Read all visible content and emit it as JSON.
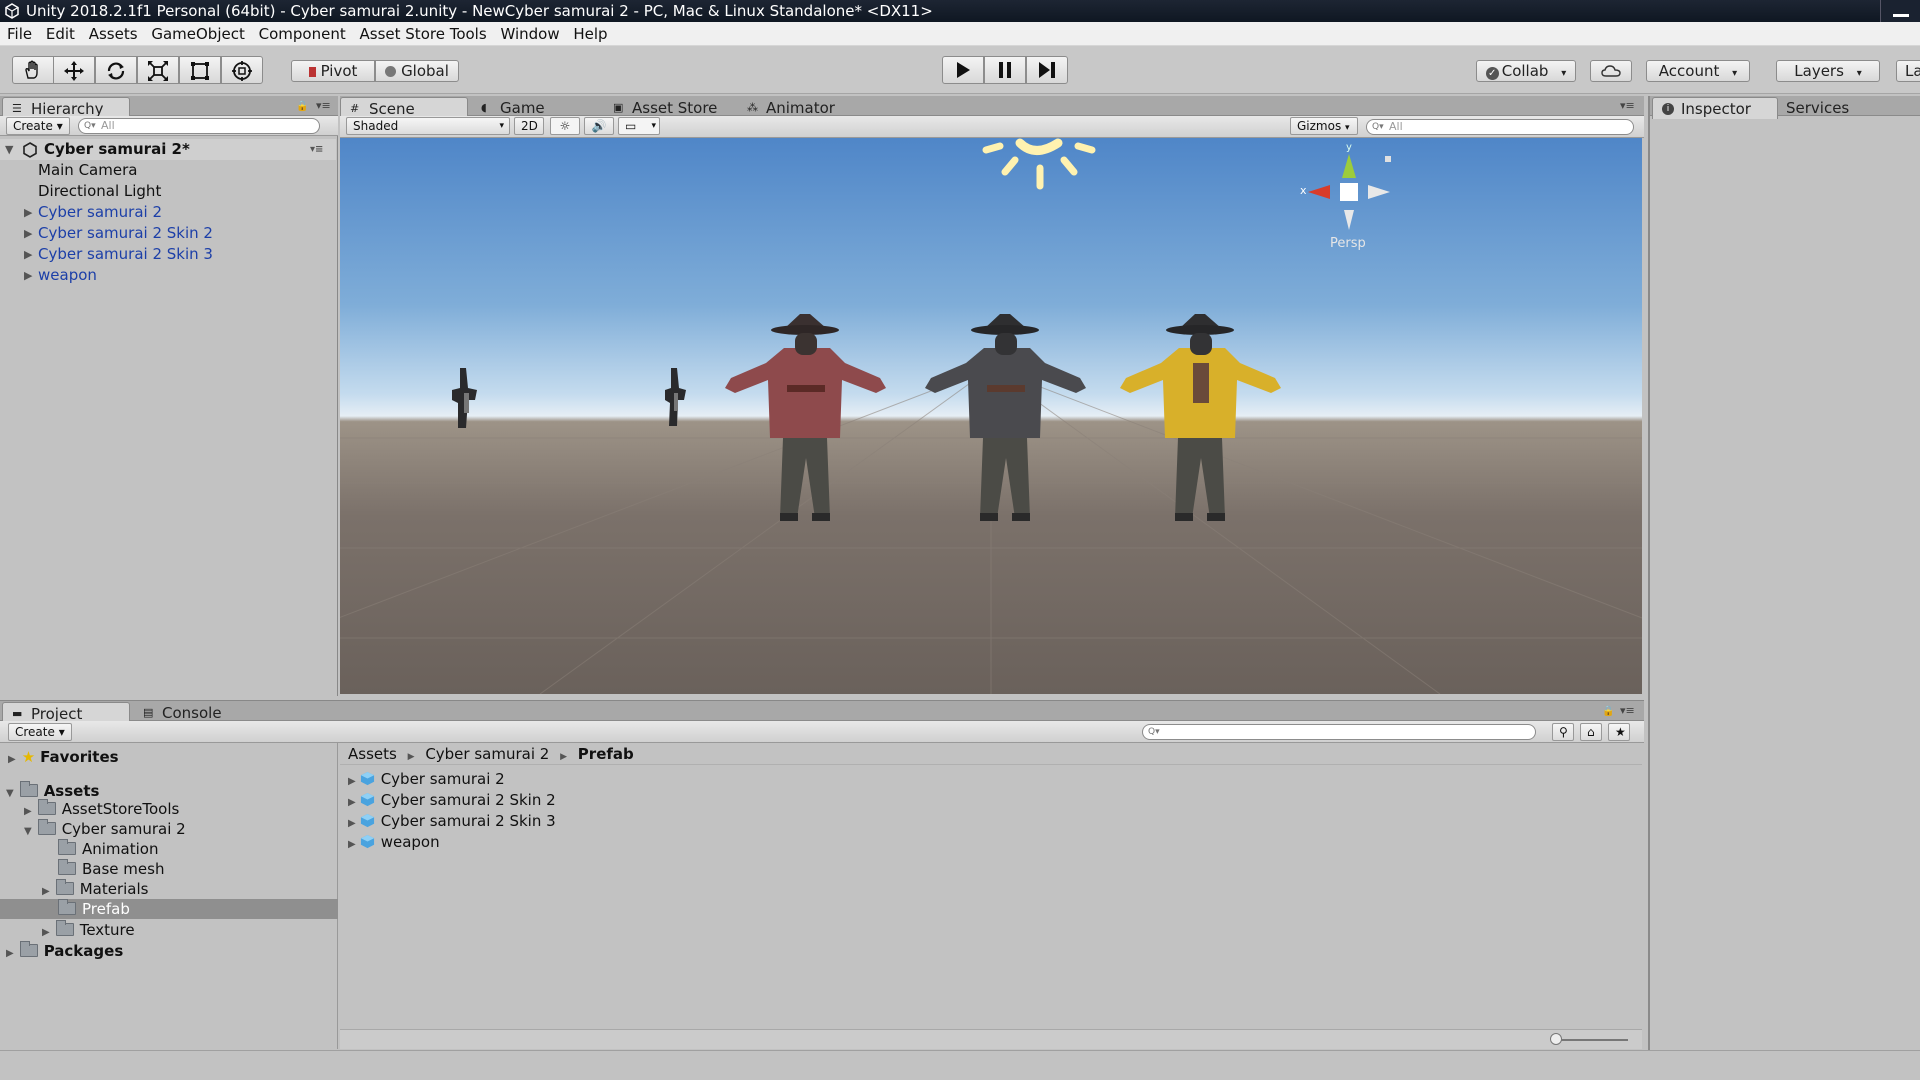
{
  "window": {
    "title": "Unity 2018.2.1f1 Personal (64bit) - Cyber samurai 2.unity - NewCyber samurai 2 - PC, Mac & Linux Standalone* <DX11>"
  },
  "menu": [
    "File",
    "Edit",
    "Assets",
    "GameObject",
    "Component",
    "Asset Store Tools",
    "Window",
    "Help"
  ],
  "toolbar": {
    "tools": [
      "hand-tool",
      "move-tool",
      "rotate-tool",
      "scale-tool",
      "rect-tool",
      "transform-tool"
    ],
    "pivot_label": "Pivot",
    "global_label": "Global",
    "collab_label": "Collab",
    "account_label": "Account",
    "layers_label": "Layers",
    "layout_label": "La"
  },
  "hierarchy": {
    "tab_label": "Hierarchy",
    "create_label": "Create",
    "search_placeholder": "All",
    "scene_name": "Cyber samurai 2*",
    "items": [
      {
        "label": "Main Camera",
        "prefab": false,
        "expandable": false
      },
      {
        "label": "Directional Light",
        "prefab": false,
        "expandable": false
      },
      {
        "label": "Cyber samurai 2",
        "prefab": true,
        "expandable": true
      },
      {
        "label": "Cyber samurai 2 Skin 2",
        "prefab": true,
        "expandable": true
      },
      {
        "label": "Cyber samurai 2 Skin 3",
        "prefab": true,
        "expandable": true
      },
      {
        "label": "weapon",
        "prefab": true,
        "expandable": true
      }
    ]
  },
  "scene": {
    "tabs": [
      "Scene",
      "Game",
      "Asset Store",
      "Animator"
    ],
    "shading_mode": "Shaded",
    "mode_2d_label": "2D",
    "gizmos_label": "Gizmos",
    "search_placeholder": "All",
    "persp_label": "Persp",
    "axis_labels": {
      "y": "y",
      "x": "x"
    }
  },
  "inspector": {
    "tabs": [
      "Inspector",
      "Services"
    ]
  },
  "project": {
    "tabs": [
      "Project",
      "Console"
    ],
    "create_label": "Create",
    "favorites_label": "Favorites",
    "assets_label": "Assets",
    "packages_label": "Packages",
    "tree": [
      {
        "label": "AssetStoreTools",
        "expandable": true
      },
      {
        "label": "Cyber samurai 2",
        "expandable": true,
        "expanded": true
      },
      {
        "label": "Animation",
        "expandable": false
      },
      {
        "label": "Base mesh",
        "expandable": false
      },
      {
        "label": "Materials",
        "expandable": true
      },
      {
        "label": "Prefab",
        "expandable": false,
        "selected": true
      },
      {
        "label": "Texture",
        "expandable": true
      }
    ],
    "breadcrumb": [
      "Assets",
      "Cyber samurai 2",
      "Prefab"
    ],
    "assets": [
      "Cyber samurai 2",
      "Cyber samurai 2 Skin 2",
      "Cyber samurai 2 Skin 3",
      "weapon"
    ]
  },
  "colors": {
    "samurai_1_coat": "#8e4a4c",
    "samurai_2_coat": "#4a4a4e",
    "samurai_3_coat": "#d8b02a",
    "prefab_text": "#1c3fa8",
    "selection": "#8f8f8f"
  }
}
